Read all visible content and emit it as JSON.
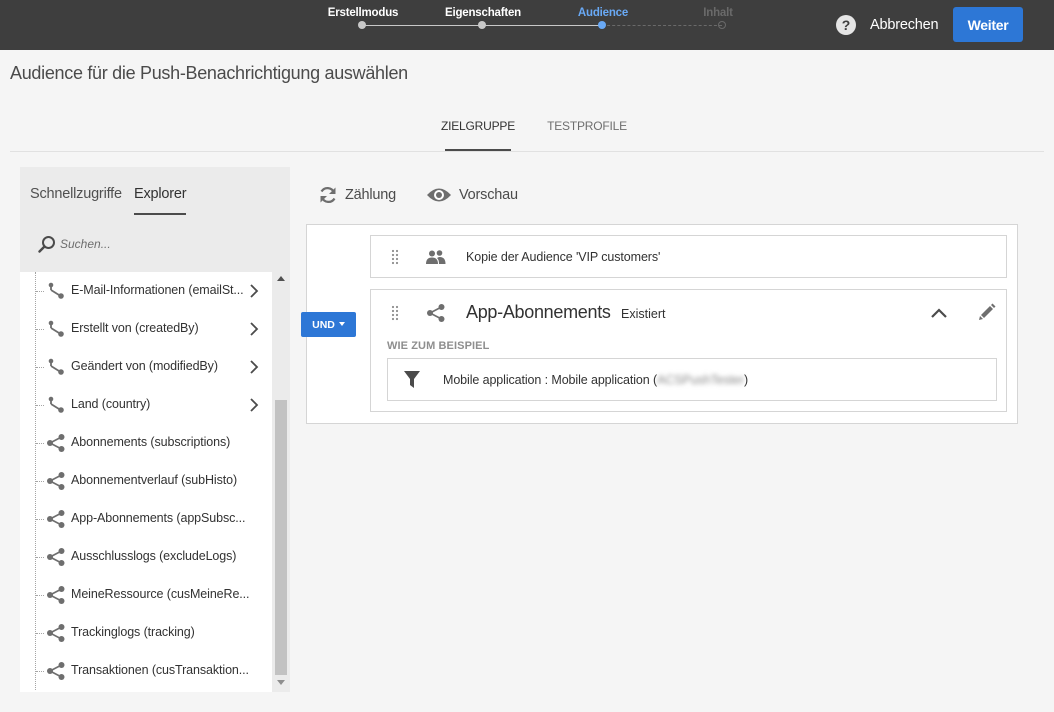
{
  "wizard": {
    "steps": [
      {
        "label": "Erstellmodus",
        "state": "done"
      },
      {
        "label": "Eigenschaften",
        "state": "done"
      },
      {
        "label": "Audience",
        "state": "active"
      },
      {
        "label": "Inhalt",
        "state": "disabled"
      }
    ],
    "help_label": "?",
    "cancel_label": "Abbrechen",
    "next_label": "Weiter"
  },
  "page": {
    "title": "Audience für die Push-Benachrichtigung auswählen",
    "tabs": [
      "ZIELGRUPPE",
      "TESTPROFILE"
    ],
    "active_tab": "ZIELGRUPPE"
  },
  "left_panel": {
    "tabs": [
      "Schnellzugriffe",
      "Explorer"
    ],
    "active_tab": "Explorer",
    "search_placeholder": "Suchen...",
    "items": [
      {
        "label": "E-Mail-Informationen (emailSt...",
        "icon": "link-icon",
        "expandable": true
      },
      {
        "label": "Erstellt von (createdBy)",
        "icon": "link-icon",
        "expandable": true
      },
      {
        "label": "Geändert von (modifiedBy)",
        "icon": "link-icon",
        "expandable": true
      },
      {
        "label": "Land (country)",
        "icon": "link-icon",
        "expandable": true
      },
      {
        "label": "Abonnements (subscriptions)",
        "icon": "share-icon",
        "expandable": false
      },
      {
        "label": "Abonnementverlauf (subHisto)",
        "icon": "share-icon",
        "expandable": false
      },
      {
        "label": "App-Abonnements (appSubsc...",
        "icon": "share-icon",
        "expandable": false
      },
      {
        "label": "Ausschlusslogs (excludeLogs)",
        "icon": "share-icon",
        "expandable": false
      },
      {
        "label": "MeineRessource (cusMeineRe...",
        "icon": "share-icon",
        "expandable": false
      },
      {
        "label": "Trackinglogs (tracking)",
        "icon": "share-icon",
        "expandable": false
      },
      {
        "label": "Transaktionen (cusTransaktion...",
        "icon": "share-icon",
        "expandable": false
      }
    ]
  },
  "toolbar": {
    "count_label": "Zählung",
    "preview_label": "Vorschau"
  },
  "query": {
    "operator_label": "UND",
    "card1_text": "Kopie der Audience 'VIP customers'",
    "card2": {
      "title": "App-Abonnements",
      "badge": "Existiert",
      "section_label": "WIE ZUM BEISPIEL",
      "filter_prefix": "Mobile application : Mobile application (",
      "filter_value": "ACSPushTester",
      "filter_suffix": ")"
    }
  },
  "colors": {
    "topbar": "#3e3e3e",
    "accent": "#2d77d6",
    "active_step": "#69a9f5"
  }
}
